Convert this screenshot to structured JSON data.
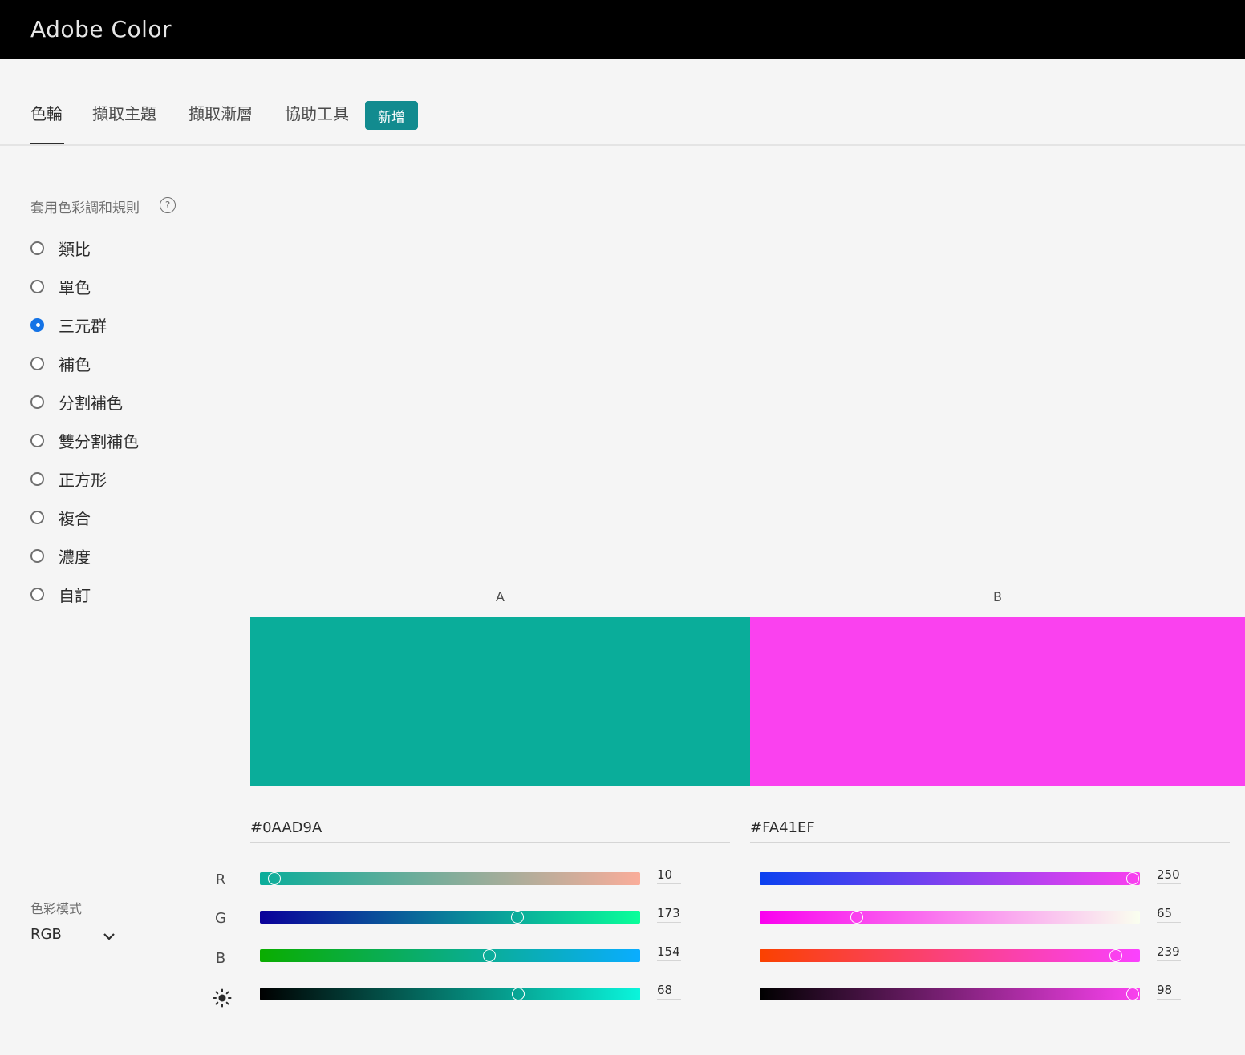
{
  "app": {
    "title": "Adobe Color"
  },
  "tabs": [
    {
      "label": "色輪",
      "active": true
    },
    {
      "label": "擷取主題",
      "active": false
    },
    {
      "label": "擷取漸層",
      "active": false
    },
    {
      "label": "協助工具",
      "active": false
    }
  ],
  "new_badge": "新增",
  "harmony": {
    "heading": "套用色彩調和規則",
    "help_icon": "question-circle-icon",
    "rules": [
      {
        "label": "類比",
        "selected": false
      },
      {
        "label": "單色",
        "selected": false
      },
      {
        "label": "三元群",
        "selected": true
      },
      {
        "label": "補色",
        "selected": false
      },
      {
        "label": "分割補色",
        "selected": false
      },
      {
        "label": "雙分割補色",
        "selected": false
      },
      {
        "label": "正方形",
        "selected": false
      },
      {
        "label": "複合",
        "selected": false
      },
      {
        "label": "濃度",
        "selected": false
      },
      {
        "label": "自訂",
        "selected": false
      }
    ]
  },
  "swatches": [
    {
      "label": "A",
      "color": "#0AAD9A",
      "hex": "#0AAD9A",
      "channels": [
        {
          "name": "R",
          "value": "10",
          "fraction": 0.039,
          "gradient": [
            "#0aad9a",
            "#faad9a"
          ]
        },
        {
          "name": "G",
          "value": "173",
          "fraction": 0.678,
          "gradient": [
            "#0a009a",
            "#0aff9a"
          ]
        },
        {
          "name": "B",
          "value": "154",
          "fraction": 0.604,
          "gradient": [
            "#0aad00",
            "#0aadff"
          ]
        },
        {
          "name": "brightness",
          "value": "68",
          "fraction": 0.68,
          "gradient": [
            "#000000",
            "#0af5dc"
          ]
        }
      ]
    },
    {
      "label": "B",
      "color": "#FA41EF",
      "hex": "#FA41EF",
      "channels": [
        {
          "name": "R",
          "value": "250",
          "fraction": 0.98,
          "gradient": [
            "#0a41ef",
            "#fa41ef"
          ]
        },
        {
          "name": "G",
          "value": "65",
          "fraction": 0.255,
          "gradient": [
            "#fa00ef",
            "#faffef"
          ]
        },
        {
          "name": "B",
          "value": "239",
          "fraction": 0.937,
          "gradient": [
            "#fa4100",
            "#fa41ff"
          ]
        },
        {
          "name": "brightness",
          "value": "98",
          "fraction": 0.98,
          "gradient": [
            "#000000",
            "#fa41ef"
          ]
        }
      ]
    }
  ],
  "channel_labels": [
    "R",
    "G",
    "B"
  ],
  "brightness_icon": "sun-icon",
  "color_mode": {
    "label": "色彩模式",
    "value": "RGB",
    "icon": "chevron-down-icon"
  }
}
